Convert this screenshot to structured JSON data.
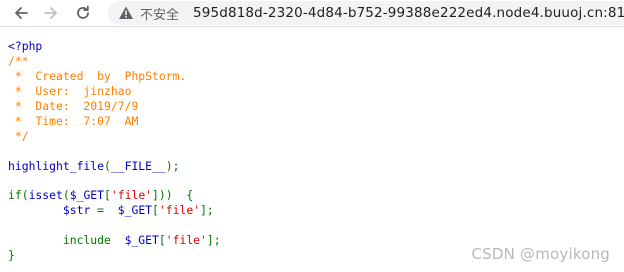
{
  "browser": {
    "security_label": "不安全",
    "url": "595d818d-2320-4d84-b752-99388e222ed4.node4.buuoj.cn:81"
  },
  "colors": {
    "code_default": "#0000bb",
    "code_comment": "#ff8000",
    "code_keyword": "#007700",
    "code_string": "#dd0000"
  },
  "code": {
    "l1": "<?php",
    "l2": "/**",
    "l3": " *  Created  by  PhpStorm.",
    "l4": " *  User:  jinzhao",
    "l5": " *  Date:  2019/7/9",
    "l6": " *  Time:  7:07  AM",
    "l7": " */",
    "l8": "",
    "l9a": "highlight_file",
    "l9b": "(",
    "l9c": "__FILE__",
    "l9d": ");",
    "l10": "",
    "l11a": "if(",
    "l11b": "isset",
    "l11c": "(",
    "l11d": "$_GET",
    "l11e": "[",
    "l11f": "'file'",
    "l11g": "]))  {",
    "l12a": "        ",
    "l12b": "$str ",
    "l12c": "= ",
    "l12d": " $_GET",
    "l12e": "[",
    "l12f": "'file'",
    "l12g": "];",
    "l13": "",
    "l14a": "        include  ",
    "l14b": "$_GET",
    "l14c": "[",
    "l14d": "'file'",
    "l14e": "];",
    "l15": "}"
  },
  "watermark": "CSDN @moyikong"
}
